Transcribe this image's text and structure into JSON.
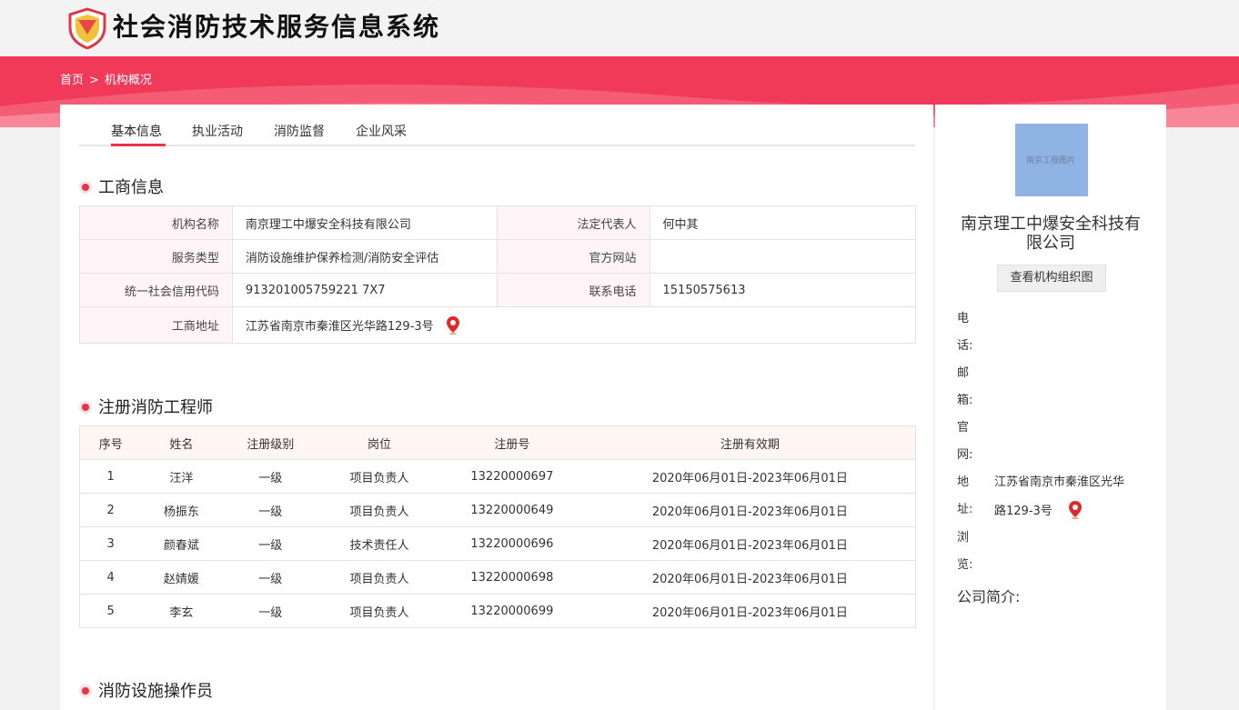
{
  "header": {
    "site_title": "社会消防技术服务信息系统"
  },
  "breadcrumb": {
    "home": "首页",
    "separator": ">",
    "current": "机构概况"
  },
  "tabs": [
    "基本信息",
    "执业活动",
    "消防监督",
    "企业风采"
  ],
  "business_info": {
    "title": "工商信息",
    "rows": [
      {
        "k1": "机构名称",
        "v1": "南京理工中爆安全科技有限公司",
        "k2": "法定代表人",
        "v2": "何中其"
      },
      {
        "k1": "服务类型",
        "v1": "消防设施维护保养检测/消防安全评估",
        "k2": "官方网站",
        "v2": ""
      },
      {
        "k1": "统一社会信用代码",
        "v1": "913201005759221 7X7",
        "k2": "联系电话",
        "v2": "15150575613"
      },
      {
        "k1": "工商地址",
        "v1": "江苏省南京市秦淮区光华路129-3号"
      }
    ]
  },
  "engineers": {
    "title": "注册消防工程师",
    "headers": [
      "序号",
      "姓名",
      "注册级别",
      "岗位",
      "注册号",
      "注册有效期"
    ],
    "rows": [
      [
        "1",
        "汪洋",
        "一级",
        "项目负责人",
        "13220000697",
        "2020年06月01日-2023年06月01日"
      ],
      [
        "2",
        "杨振东",
        "一级",
        "项目负责人",
        "13220000649",
        "2020年06月01日-2023年06月01日"
      ],
      [
        "3",
        "颜春斌",
        "一级",
        "技术责任人",
        "13220000696",
        "2020年06月01日-2023年06月01日"
      ],
      [
        "4",
        "赵婧媛",
        "一级",
        "项目负责人",
        "13220000698",
        "2020年06月01日-2023年06月01日"
      ],
      [
        "5",
        "李玄",
        "一级",
        "项目负责人",
        "13220000699",
        "2020年06月01日-2023年06月01日"
      ]
    ]
  },
  "operators": {
    "title": "消防设施操作员"
  },
  "sidebar": {
    "logo_text": "南京工程图片",
    "org_name": "南京理工中爆安全科技有限公司",
    "org_chart_button": "查看机构组织图",
    "phone_label": [
      "电",
      "话:"
    ],
    "email_label": [
      "邮",
      "箱:"
    ],
    "website_label": [
      "官",
      "网:"
    ],
    "address_label": [
      "地",
      "址:"
    ],
    "address_value": [
      "江苏省南京市秦淮区光华",
      "路129-3号"
    ],
    "views_label": [
      "浏",
      "览:"
    ],
    "intro_label": "公司简介:"
  },
  "colors": {
    "brand_red": "#f1395a",
    "accent": "#e8334a"
  }
}
